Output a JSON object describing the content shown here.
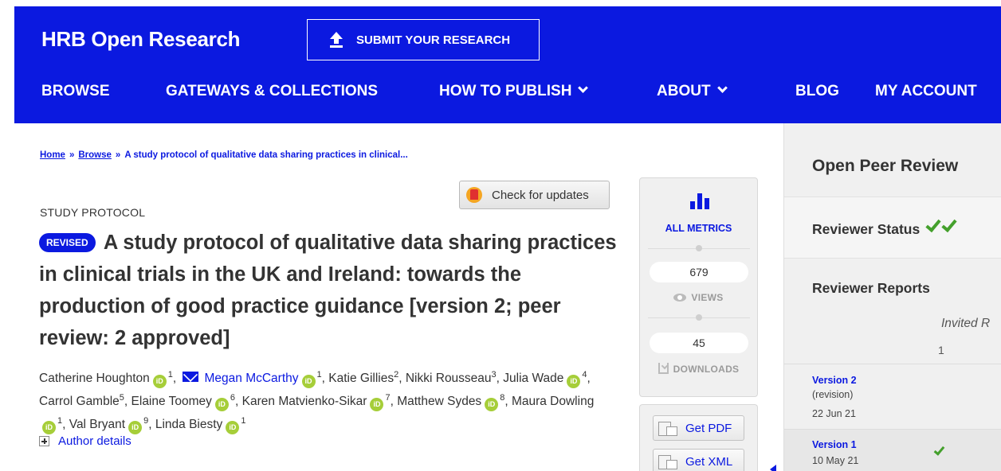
{
  "header": {
    "brand": "HRB Open Research",
    "submit_label": "SUBMIT YOUR RESEARCH",
    "nav": {
      "browse": "BROWSE",
      "gateways": "GATEWAYS & COLLECTIONS",
      "how_to_publish": "HOW TO PUBLISH",
      "about": "ABOUT",
      "blog": "BLOG",
      "my_account": "MY ACCOUNT"
    },
    "accent_color": "#0b19e0"
  },
  "breadcrumb": {
    "home": "Home",
    "sep": "»",
    "browse": "Browse",
    "current": "A study protocol of qualitative data sharing practices in clinical..."
  },
  "check_updates": "Check for updates",
  "article": {
    "type": "STUDY PROTOCOL",
    "revised_badge": "REVISED",
    "title": "A study protocol of qualitative data sharing practices in clinical trials in the UK and Ireland: towards the production of good practice guidance [version 2; peer review: 2 approved]",
    "author_details": "Author details",
    "orcid_label": "iD",
    "authors": [
      {
        "name": "Catherine Houghton",
        "aff": "1",
        "orcid": true
      },
      {
        "name": "Megan McCarthy",
        "aff": "1",
        "orcid": true,
        "corresponding": true
      },
      {
        "name": "Katie Gillies",
        "aff": "2"
      },
      {
        "name": "Nikki Rousseau",
        "aff": "3"
      },
      {
        "name": "Julia Wade",
        "aff": "4",
        "orcid": true
      },
      {
        "name": "Carrol Gamble",
        "aff": "5"
      },
      {
        "name": "Elaine Toomey",
        "aff": "6",
        "orcid": true
      },
      {
        "name": "Karen Matvienko-Sikar",
        "aff": "7",
        "orcid": true
      },
      {
        "name": "Matthew Sydes",
        "aff": "8",
        "orcid": true
      },
      {
        "name": "Maura Dowling",
        "aff": "1",
        "orcid": true
      },
      {
        "name": "Val Bryant",
        "aff": "9",
        "orcid": true
      },
      {
        "name": "Linda Biesty",
        "aff": "1",
        "orcid": true
      }
    ]
  },
  "metrics": {
    "all_metrics": "ALL METRICS",
    "views_count": "679",
    "views_label": "VIEWS",
    "downloads_count": "45",
    "downloads_label": "DOWNLOADS",
    "get_pdf": "Get PDF",
    "get_xml": "Get XML"
  },
  "peer_review": {
    "title": "Open Peer Review",
    "status_label": "Reviewer Status",
    "reports_label": "Reviewer Reports",
    "invited_label": "Invited R",
    "invited_count": "1",
    "versions": [
      {
        "title": "Version 2",
        "note": "(revision)",
        "date": "22 Jun 21"
      },
      {
        "title": "Version 1",
        "date": "10 May 21"
      }
    ]
  }
}
